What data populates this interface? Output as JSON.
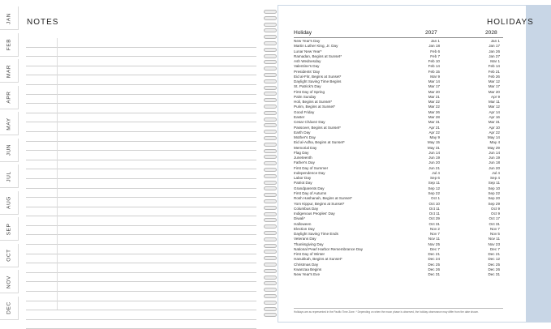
{
  "months": [
    "JAN",
    "FEB",
    "MAR",
    "APR",
    "MAY",
    "JUN",
    "JUL",
    "AUG",
    "SEP",
    "OCT",
    "NOV",
    "DEC"
  ],
  "notes": {
    "title": "NOTES"
  },
  "holidays": {
    "title": "HOLIDAYS",
    "col_holiday": "Holiday",
    "col_2027": "2027",
    "col_2028": "2028",
    "rows": [
      {
        "name": "New Year's Day",
        "y2027": "Jan 1",
        "y2028": "Jan 1"
      },
      {
        "name": "Martin Luther King, Jr. Day",
        "y2027": "Jan 18",
        "y2028": "Jan 17"
      },
      {
        "name": "Lunar New Year*",
        "y2027": "Feb 6",
        "y2028": "Jan 26"
      },
      {
        "name": "Ramadan, Begins at Sunset*",
        "y2027": "Feb 7",
        "y2028": "Jan 27"
      },
      {
        "name": "Ash Wednesday",
        "y2027": "Feb 10",
        "y2028": "Mar 1"
      },
      {
        "name": "Valentine's Day",
        "y2027": "Feb 14",
        "y2028": "Feb 14"
      },
      {
        "name": "Presidents' Day",
        "y2027": "Feb 15",
        "y2028": "Feb 21"
      },
      {
        "name": "Eid al-Fitr, Begins at Sunset*",
        "y2027": "Mar 9",
        "y2028": "Feb 26"
      },
      {
        "name": "Daylight Saving Time Begins",
        "y2027": "Mar 14",
        "y2028": "Mar 12"
      },
      {
        "name": "St. Patrick's Day",
        "y2027": "Mar 17",
        "y2028": "Mar 17"
      },
      {
        "name": "First Day of Spring",
        "y2027": "Mar 20",
        "y2028": "Mar 20"
      },
      {
        "name": "Palm Sunday",
        "y2027": "Mar 21",
        "y2028": "Apr 9"
      },
      {
        "name": "Holi, Begins at Sunset*",
        "y2027": "Mar 22",
        "y2028": "Mar 11"
      },
      {
        "name": "Purim, Begins at Sunset*",
        "y2027": "Mar 22",
        "y2028": "Mar 12"
      },
      {
        "name": "Good Friday",
        "y2027": "Mar 26",
        "y2028": "Apr 14"
      },
      {
        "name": "Easter",
        "y2027": "Mar 28",
        "y2028": "Apr 16"
      },
      {
        "name": "Cesar Chávez Day",
        "y2027": "Mar 31",
        "y2028": "Mar 31"
      },
      {
        "name": "Passover, Begins at Sunset*",
        "y2027": "Apr 21",
        "y2028": "Apr 10"
      },
      {
        "name": "Earth Day",
        "y2027": "Apr 22",
        "y2028": "Apr 22"
      },
      {
        "name": "Mother's Day",
        "y2027": "May 9",
        "y2028": "May 14"
      },
      {
        "name": "Eid al-Adha, Begins at Sunset*",
        "y2027": "May 15",
        "y2028": "May 4"
      },
      {
        "name": "Memorial Day",
        "y2027": "May 31",
        "y2028": "May 29"
      },
      {
        "name": "Flag Day",
        "y2027": "Jun 14",
        "y2028": "Jun 14"
      },
      {
        "name": "Juneteenth",
        "y2027": "Jun 19",
        "y2028": "Jun 19"
      },
      {
        "name": "Father's Day",
        "y2027": "Jun 20",
        "y2028": "Jun 18"
      },
      {
        "name": "First Day of Summer",
        "y2027": "Jun 21",
        "y2028": "Jun 20"
      },
      {
        "name": "Independence Day",
        "y2027": "Jul 4",
        "y2028": "Jul 4"
      },
      {
        "name": "Labor Day",
        "y2027": "Sep 6",
        "y2028": "Sep 4"
      },
      {
        "name": "Patriot Day",
        "y2027": "Sep 11",
        "y2028": "Sep 11"
      },
      {
        "name": "Grandparents Day",
        "y2027": "Sep 12",
        "y2028": "Sep 10"
      },
      {
        "name": "First Day of Autumn",
        "y2027": "Sep 22",
        "y2028": "Sep 22"
      },
      {
        "name": "Rosh Hashanah, Begins at Sunset*",
        "y2027": "Oct 1",
        "y2028": "Sep 20"
      },
      {
        "name": "Yom Kippur, Begins at Sunset*",
        "y2027": "Oct 10",
        "y2028": "Sep 29"
      },
      {
        "name": "Columbus Day",
        "y2027": "Oct 11",
        "y2028": "Oct 9"
      },
      {
        "name": "Indigenous Peoples' Day",
        "y2027": "Oct 11",
        "y2028": "Oct 9"
      },
      {
        "name": "Diwali*",
        "y2027": "Oct 29",
        "y2028": "Oct 17"
      },
      {
        "name": "Halloween",
        "y2027": "Oct 31",
        "y2028": "Oct 31"
      },
      {
        "name": "Election Day",
        "y2027": "Nov 2",
        "y2028": "Nov 7"
      },
      {
        "name": "Daylight Saving Time Ends",
        "y2027": "Nov 7",
        "y2028": "Nov 5"
      },
      {
        "name": "Veterans Day",
        "y2027": "Nov 11",
        "y2028": "Nov 11"
      },
      {
        "name": "Thanksgiving Day",
        "y2027": "Nov 25",
        "y2028": "Nov 23"
      },
      {
        "name": "National Pearl Harbor Remembrance Day",
        "y2027": "Dec 7",
        "y2028": "Dec 7"
      },
      {
        "name": "First Day of Winter",
        "y2027": "Dec 21",
        "y2028": "Dec 21"
      },
      {
        "name": "Hanukkah, Begins at Sunset*",
        "y2027": "Dec 24",
        "y2028": "Dec 12"
      },
      {
        "name": "Christmas Day",
        "y2027": "Dec 25",
        "y2028": "Dec 25"
      },
      {
        "name": "Kwanzaa Begins",
        "y2027": "Dec 26",
        "y2028": "Dec 26"
      },
      {
        "name": "New Year's Eve",
        "y2027": "Dec 31",
        "y2028": "Dec 31"
      }
    ],
    "footnote": "Holidays are as represented in the Pacific Time Zone.  * Depending on when the moon phase is observed, the holiday observance may differ from the date shown."
  }
}
